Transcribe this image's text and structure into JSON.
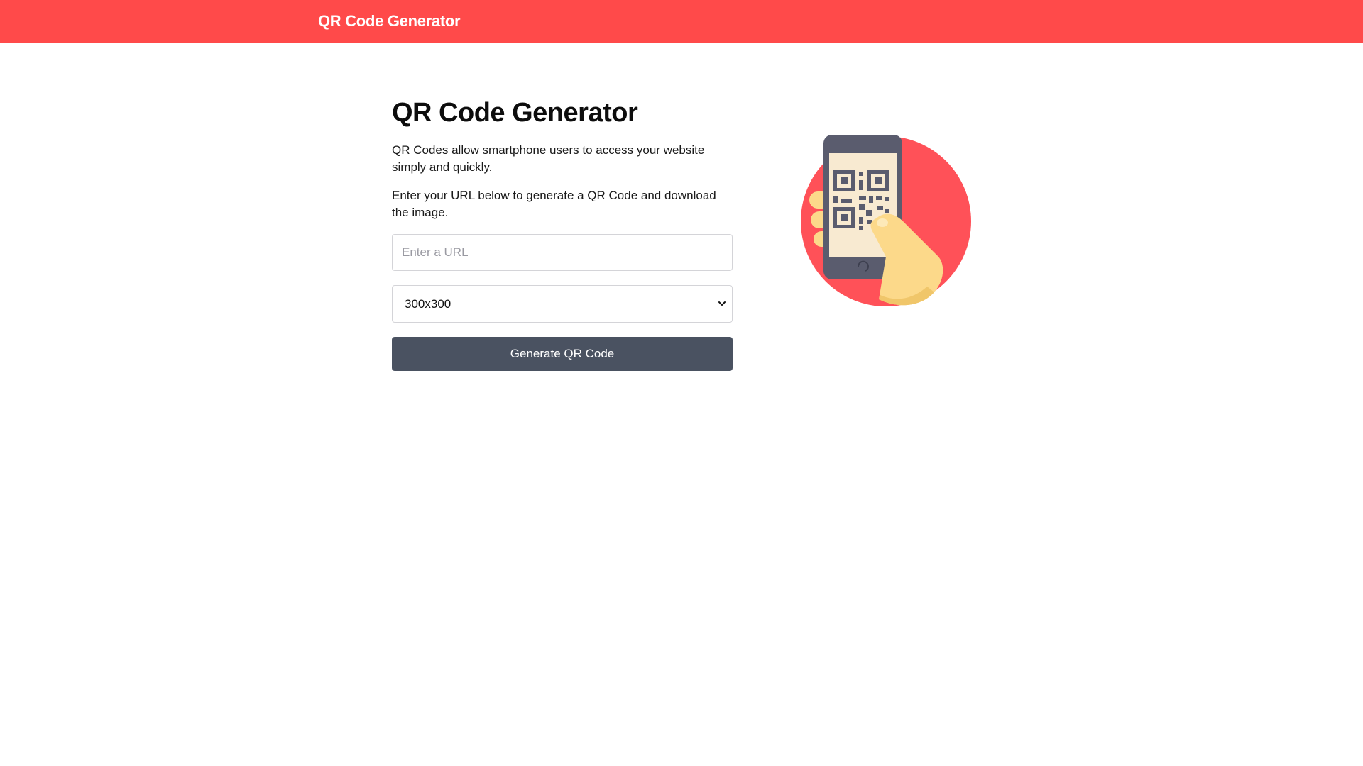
{
  "header": {
    "brand": "QR Code Generator",
    "background_color": "#ff4a4a"
  },
  "main": {
    "title": "QR Code Generator",
    "paragraph_1": "QR Codes allow smartphone users to access your website simply and quickly.",
    "paragraph_2": "Enter your URL below to generate a QR Code and download the image.",
    "url_input": {
      "value": "",
      "placeholder": "Enter a URL"
    },
    "size_select": {
      "selected": "300x300"
    },
    "generate_button": {
      "label": "Generate QR Code",
      "color": "#4a5261"
    }
  },
  "illustration": {
    "icon": "hand-holding-phone-with-qr-code",
    "circle_color": "#ff5158"
  }
}
